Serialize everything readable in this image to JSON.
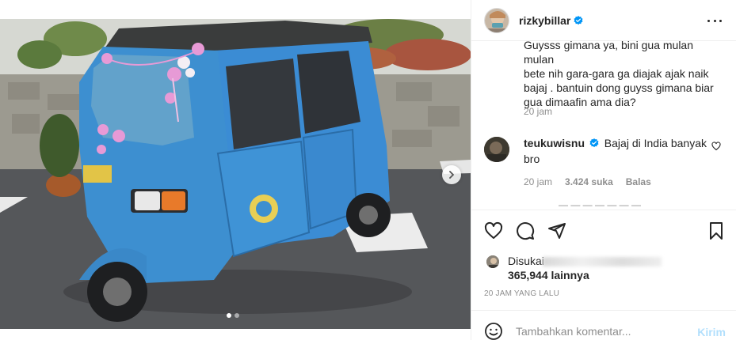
{
  "post": {
    "username": "rizkybillar",
    "caption_lines": [
      "Guysss gimana ya, bini gua mulan mulan",
      "bete nih gara-gara ga diajak ajak naik",
      "bajaj . bantuin dong guyss gimana biar",
      "gua dimaafin ama dia?"
    ],
    "caption_time": "20 jam",
    "time_ago": "20 JAM YANG LALU"
  },
  "comment": {
    "username": "teukuwisnu",
    "text": "Bajaj di India banyak bro",
    "time": "20 jam",
    "likes": "3.424 suka",
    "reply": "Balas"
  },
  "likes": {
    "liked_by_prefix": "Disukai",
    "count": "365,944 lainnya"
  },
  "add_comment": {
    "placeholder": "Tambahkan komentar...",
    "post_label": "Kirim"
  },
  "icons": {
    "verified": "verified-badge-icon",
    "more": "more-options-icon",
    "like": "heart-icon",
    "comment": "comment-icon",
    "share": "share-icon",
    "save": "bookmark-icon",
    "emoji": "emoji-icon",
    "next": "chevron-right-icon"
  },
  "colors": {
    "verified_blue": "#0095f6",
    "post_button_disabled": "#b2dffc",
    "bajaj_blue": "#3d8fd0"
  },
  "carousel": {
    "slide_count": 2,
    "active_slide": 1
  }
}
